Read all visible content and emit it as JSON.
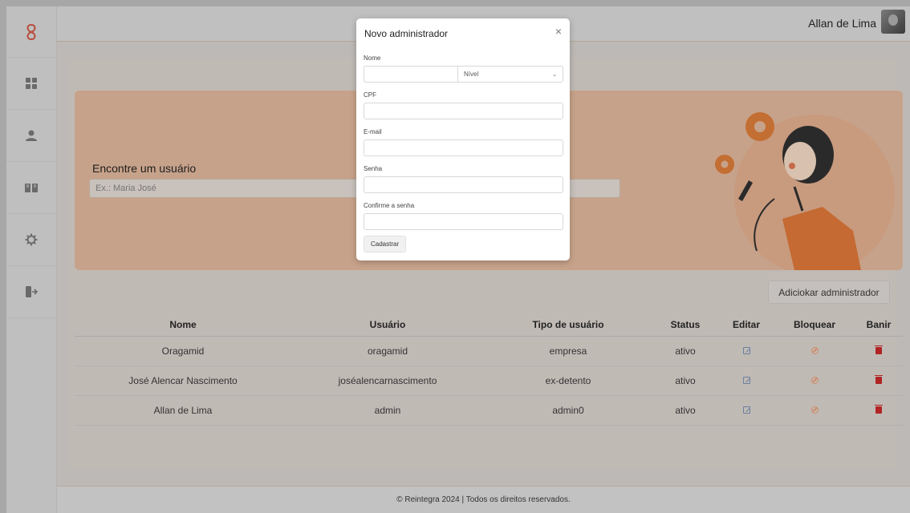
{
  "header": {
    "user_name": "Allan de Lima"
  },
  "search": {
    "title": "Encontre um usuário",
    "placeholder": "Ex.: Maria José"
  },
  "actions": {
    "add_admin_label": "Adiciokar administrador"
  },
  "table": {
    "headers": [
      "Nome",
      "Usuário",
      "Tipo de usuário",
      "Status",
      "Editar",
      "Bloquear",
      "Banir"
    ],
    "rows": [
      {
        "nome": "Oragamid",
        "usuario": "oragamid",
        "tipo": "empresa",
        "status": "ativo"
      },
      {
        "nome": "José Alencar Nascimento",
        "usuario": "joséalencarnascimento",
        "tipo": "ex-detento",
        "status": "ativo"
      },
      {
        "nome": "Allan de Lima",
        "usuario": "admin",
        "tipo": "admin0",
        "status": "ativo"
      }
    ]
  },
  "footer": {
    "text": "© Reintegra 2024 | Todos os direitos reservados."
  },
  "modal": {
    "title": "Novo administrador",
    "close": "×",
    "fields": {
      "nome_label": "Nome",
      "nivel_value": "Nível",
      "cpf_label": "CPF",
      "email_label": "E-mail",
      "senha_label": "Senha",
      "confirm_label": "Confirme a senha"
    },
    "submit_label": "Cadastrar"
  },
  "colors": {
    "accent": "#c76f3a",
    "hero_bg": "#c7a28a",
    "ban_red": "#b02424",
    "block_orange": "#d18a68",
    "edit_blue": "#6c7fa0"
  },
  "icons": [
    "logo-knot-icon",
    "dashboard-grid-icon",
    "user-icon",
    "book-icon",
    "gear-icon",
    "logout-icon",
    "edit-icon",
    "block-icon",
    "trash-icon",
    "close-icon",
    "chevron-down-icon"
  ]
}
